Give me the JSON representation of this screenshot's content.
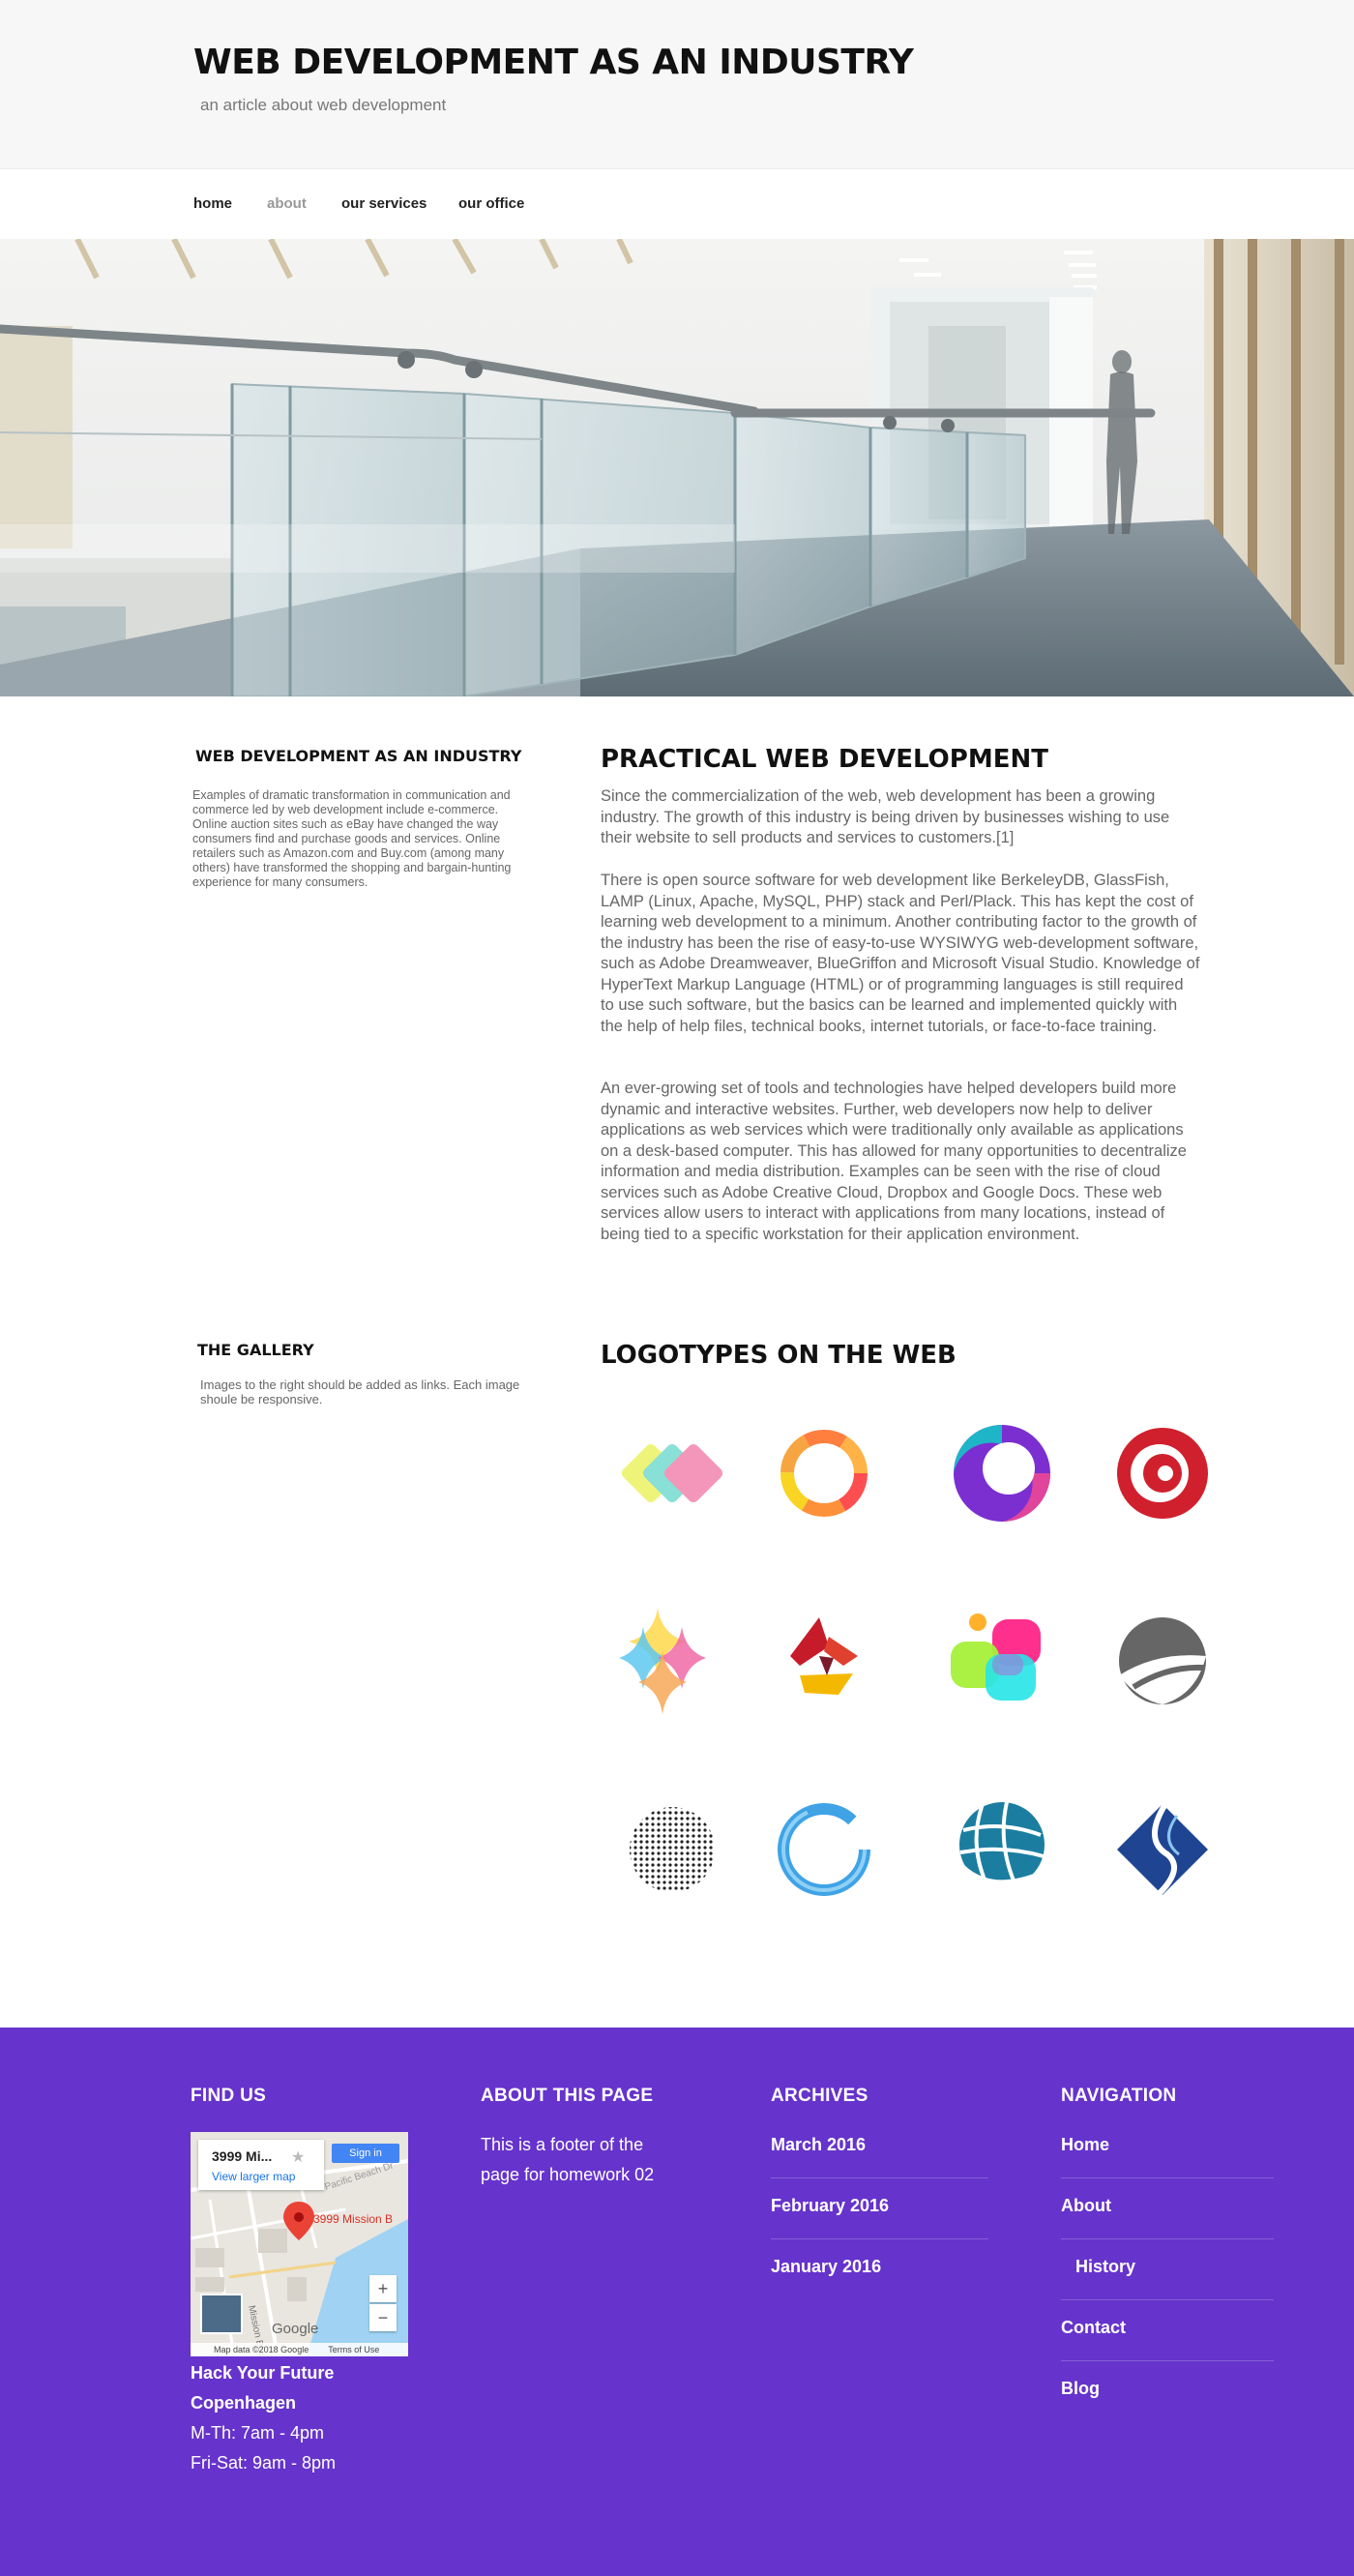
{
  "header": {
    "title": "WEB DEVELOPMENT AS AN INDUSTRY",
    "tagline": "an article about web development"
  },
  "nav": {
    "items": [
      {
        "label": "home",
        "active": false
      },
      {
        "label": "about",
        "active": true
      },
      {
        "label": "our services",
        "active": false
      },
      {
        "label": "our office",
        "active": false
      }
    ]
  },
  "intro": {
    "sidebar_heading": "WEB DEVELOPMENT AS AN INDUSTRY",
    "sidebar_text": "Examples of dramatic transformation in communication and commerce led by web development include e-commerce. Online auction sites such as eBay have changed the way consumers find and purchase goods and services. Online retailers such as Amazon.com and Buy.com (among many others) have transformed the shopping and bargain-hunting experience for many consumers.",
    "heading": "PRACTICAL WEB DEVELOPMENT",
    "paragraphs": [
      "Since the commercialization of the web, web development has been a growing industry. The growth of this industry is being driven by businesses wishing to use their website to sell products and services to customers.[1]",
      "There is open source software for web development like BerkeleyDB, GlassFish, LAMP (Linux, Apache, MySQL, PHP) stack and Perl/Plack. This has kept the cost of learning web development to a minimum. Another contributing factor to the growth of the industry has been the rise of easy-to-use WYSIWYG web-development software, such as Adobe Dreamweaver, BlueGriffon and Microsoft Visual Studio. Knowledge of HyperText Markup Language (HTML) or of programming languages is still required to use such software, but the basics can be learned and implemented quickly with the help of help files, technical books, internet tutorials, or face-to-face training.",
      "An ever-growing set of tools and technologies have helped developers build more dynamic and interactive websites. Further, web developers now help to deliver applications as web services which were traditionally only available as applications on a desk-based computer. This has allowed for many opportunities to decentralize information and media distribution. Examples can be seen with the rise of cloud services such as Adobe Creative Cloud, Dropbox and Google Docs. These web services allow users to interact with applications from many locations, instead of being tied to a specific workstation for their application environment."
    ]
  },
  "gallery": {
    "sidebar_heading": "THE GALLERY",
    "sidebar_text": "Images to the right should be added as links. Each image shoule be responsive.",
    "heading": "LOGOTYPES ON THE WEB",
    "logos": [
      "overlapping-diamonds-logo-icon",
      "rainbow-ring-logo-icon",
      "purple-swirl-logo-icon",
      "red-target-logo-icon",
      "sparkle-stars-logo-icon",
      "paint-splash-logo-icon",
      "color-blobs-logo-icon",
      "gray-crescent-logo-icon",
      "dotted-sphere-logo-icon",
      "blue-brush-ring-logo-icon",
      "teal-globe-logo-icon",
      "blue-diamond-logo-icon"
    ]
  },
  "footer": {
    "find_us": {
      "heading": "FIND US",
      "map": {
        "card_title": "3999 Mi...",
        "card_link": "View larger map",
        "signin": "Sign in",
        "pin_label": "3999 Mission B",
        "google": "Google",
        "map_data": "Map data ©2018 Google",
        "terms": "Terms of Use",
        "zoom_in": "+",
        "zoom_out": "−",
        "road_mission": "Mission Blvd",
        "road_pacific": "Pacific Beach Dr"
      },
      "address_lines": [
        "Hack Your Future",
        "Copenhagen"
      ],
      "hours": [
        "M-Th: 7am - 4pm",
        "Fri-Sat: 9am - 8pm"
      ]
    },
    "about": {
      "heading": "ABOUT THIS PAGE",
      "text": "This is a footer of the page for homework 02"
    },
    "archives": {
      "heading": "ARCHIVES",
      "items": [
        "March 2016",
        "February 2016",
        "January 2016"
      ]
    },
    "navigation": {
      "heading": "NAVIGATION",
      "items": [
        "Home",
        "About",
        "History",
        "Contact",
        "Blog"
      ]
    },
    "accent_color": "#6633cc"
  }
}
